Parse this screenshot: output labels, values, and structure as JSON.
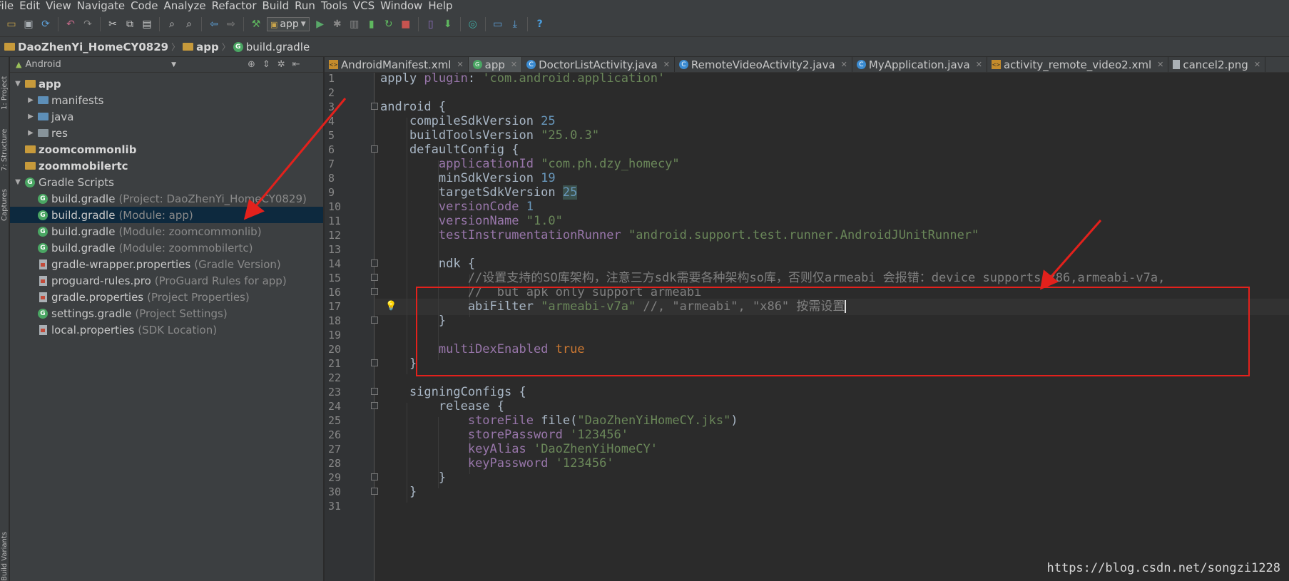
{
  "menu": {
    "items": [
      "File",
      "Edit",
      "View",
      "Navigate",
      "Code",
      "Analyze",
      "Refactor",
      "Build",
      "Run",
      "Tools",
      "VCS",
      "Window",
      "Help"
    ]
  },
  "toolbar": {
    "run_config": "app",
    "icons": [
      "open-icon",
      "save-icon",
      "sync-icon",
      "undo-icon",
      "redo-icon",
      "cut-icon",
      "copy-icon",
      "paste-icon",
      "find-icon",
      "replace-icon",
      "back-icon",
      "forward-icon",
      "build-icon",
      "run-icon",
      "debug-icon",
      "profile-icon",
      "attach-icon",
      "apply-changes-icon",
      "stop-icon",
      "avd-icon",
      "sdk-manager-icon",
      "gradle-sync-icon",
      "device-monitor-icon",
      "download-icon",
      "help-icon"
    ]
  },
  "breadcrumb": {
    "project": "DaoZhenYi_HomeCY0829",
    "module": "app",
    "file": "build.gradle"
  },
  "toolstrip": {
    "project_tab": "1: Project",
    "structure_tab": "7: Structure",
    "captures_tab": "Captures",
    "variants_tab": "Build Variants"
  },
  "project_panel": {
    "view_mode": "Android",
    "tree": [
      {
        "name": "app",
        "hint": "",
        "level": 0,
        "expanded": true,
        "icon": "module",
        "bold": true
      },
      {
        "name": "manifests",
        "hint": "",
        "level": 1,
        "expanded": false,
        "icon": "folder-blue",
        "bold": false
      },
      {
        "name": "java",
        "hint": "",
        "level": 1,
        "expanded": false,
        "icon": "folder-blue",
        "bold": false
      },
      {
        "name": "res",
        "hint": "",
        "level": 1,
        "expanded": false,
        "icon": "folder-res",
        "bold": false
      },
      {
        "name": "zoomcommonlib",
        "hint": "",
        "level": 0,
        "expanded": null,
        "icon": "module",
        "bold": true
      },
      {
        "name": "zoommobilertc",
        "hint": "",
        "level": 0,
        "expanded": null,
        "icon": "module",
        "bold": true
      },
      {
        "name": "Gradle Scripts",
        "hint": "",
        "level": 0,
        "expanded": true,
        "icon": "gradle",
        "bold": false
      },
      {
        "name": "build.gradle",
        "hint": "(Project: DaoZhenYi_HomeCY0829)",
        "level": 1,
        "expanded": null,
        "icon": "gradle",
        "bold": false
      },
      {
        "name": "build.gradle",
        "hint": "(Module: app)",
        "level": 1,
        "expanded": null,
        "icon": "gradle",
        "bold": false,
        "selected": true
      },
      {
        "name": "build.gradle",
        "hint": "(Module: zoomcommonlib)",
        "level": 1,
        "expanded": null,
        "icon": "gradle",
        "bold": false
      },
      {
        "name": "build.gradle",
        "hint": "(Module: zoommobilertc)",
        "level": 1,
        "expanded": null,
        "icon": "gradle",
        "bold": false
      },
      {
        "name": "gradle-wrapper.properties",
        "hint": "(Gradle Version)",
        "level": 1,
        "expanded": null,
        "icon": "properties",
        "bold": false
      },
      {
        "name": "proguard-rules.pro",
        "hint": "(ProGuard Rules for app)",
        "level": 1,
        "expanded": null,
        "icon": "text",
        "bold": false
      },
      {
        "name": "gradle.properties",
        "hint": "(Project Properties)",
        "level": 1,
        "expanded": null,
        "icon": "properties",
        "bold": false
      },
      {
        "name": "settings.gradle",
        "hint": "(Project Settings)",
        "level": 1,
        "expanded": null,
        "icon": "gradle",
        "bold": false
      },
      {
        "name": "local.properties",
        "hint": "(SDK Location)",
        "level": 1,
        "expanded": null,
        "icon": "properties",
        "bold": false
      }
    ]
  },
  "tabs": [
    {
      "label": "AndroidManifest.xml",
      "icon": "xml",
      "active": false
    },
    {
      "label": "app",
      "icon": "gradle",
      "active": true
    },
    {
      "label": "DoctorListActivity.java",
      "icon": "class",
      "active": false
    },
    {
      "label": "RemoteVideoActivity2.java",
      "icon": "class",
      "active": false
    },
    {
      "label": "MyApplication.java",
      "icon": "class",
      "active": false
    },
    {
      "label": "activity_remote_video2.xml",
      "icon": "xml",
      "active": false
    },
    {
      "label": "cancel2.png",
      "icon": "image",
      "active": false
    }
  ],
  "editor": {
    "line_numbers": [
      "1",
      "2",
      "3",
      "4",
      "5",
      "6",
      "7",
      "8",
      "9",
      "10",
      "11",
      "12",
      "13",
      "14",
      "15",
      "16",
      "17",
      "18",
      "19",
      "20",
      "21",
      "22",
      "23",
      "24",
      "25",
      "26",
      "27",
      "28",
      "29",
      "30",
      "31"
    ],
    "lines": [
      [
        [
          "fn",
          "apply "
        ],
        [
          "prop",
          "plugin"
        ],
        [
          "fn",
          ": "
        ],
        [
          "str",
          "'com.android.application'"
        ]
      ],
      [],
      [
        [
          "fn",
          "android {"
        ]
      ],
      [
        [
          "fn",
          "    compileSdkVersion "
        ],
        [
          "num",
          "25"
        ]
      ],
      [
        [
          "fn",
          "    buildToolsVersion "
        ],
        [
          "str",
          "\"25.0.3\""
        ]
      ],
      [
        [
          "fn",
          "    defaultConfig {"
        ]
      ],
      [
        [
          "fn",
          "        "
        ],
        [
          "prop",
          "applicationId "
        ],
        [
          "str",
          "\"com.ph.dzy_homecy\""
        ]
      ],
      [
        [
          "fn",
          "        minSdkVersion "
        ],
        [
          "num",
          "19"
        ]
      ],
      [
        [
          "fn",
          "        targetSdkVersion "
        ],
        [
          "numhl",
          "25"
        ]
      ],
      [
        [
          "fn",
          "        "
        ],
        [
          "prop",
          "versionCode "
        ],
        [
          "num",
          "1"
        ]
      ],
      [
        [
          "fn",
          "        "
        ],
        [
          "prop",
          "versionName "
        ],
        [
          "str",
          "\"1.0\""
        ]
      ],
      [
        [
          "fn",
          "        "
        ],
        [
          "prop",
          "testInstrumentationRunner "
        ],
        [
          "str",
          "\"android.support.test.runner.AndroidJUnitRunner\""
        ]
      ],
      [],
      [
        [
          "fn",
          "        ndk {"
        ]
      ],
      [
        [
          "cmt",
          "            //设置支持的SO库架构，注意三方sdk需要各种架构so库，否则仅armeabi 会报错：device supports x86,armeabi-v7a,"
        ]
      ],
      [
        [
          "cmt",
          "            //  but apk only support armeabi"
        ]
      ],
      [
        [
          "fn",
          "            abiFilter "
        ],
        [
          "str",
          "\"armeabi-v7a\" "
        ],
        [
          "cmt",
          "//, \"armeabi\", \"x86\" 按需设置"
        ],
        [
          "caret",
          ""
        ]
      ],
      [
        [
          "fn",
          "        }"
        ]
      ],
      [],
      [
        [
          "fn",
          "        "
        ],
        [
          "prop",
          "multiDexEnabled "
        ],
        [
          "kw",
          "true"
        ]
      ],
      [
        [
          "fn",
          "    }"
        ]
      ],
      [],
      [
        [
          "fn",
          "    signingConfigs {"
        ]
      ],
      [
        [
          "fn",
          "        release {"
        ]
      ],
      [
        [
          "fn",
          "            "
        ],
        [
          "prop",
          "storeFile "
        ],
        [
          "fn",
          "file("
        ],
        [
          "str",
          "\"DaoZhenYiHomeCY.jks\""
        ],
        [
          "fn",
          ")"
        ]
      ],
      [
        [
          "fn",
          "            "
        ],
        [
          "prop",
          "storePassword "
        ],
        [
          "str",
          "'123456'"
        ]
      ],
      [
        [
          "fn",
          "            "
        ],
        [
          "prop",
          "keyAlias "
        ],
        [
          "str",
          "'DaoZhenYiHomeCY'"
        ]
      ],
      [
        [
          "fn",
          "            "
        ],
        [
          "prop",
          "keyPassword "
        ],
        [
          "str",
          "'123456'"
        ]
      ],
      [
        [
          "fn",
          "        }"
        ]
      ],
      [
        [
          "fn",
          "    }"
        ]
      ],
      []
    ],
    "current_line": 17
  },
  "colors": {
    "annotation_red": "#e3211c",
    "background": "#2b2b2b",
    "panel": "#3c3f41",
    "selection": "#0d293e"
  },
  "watermark": "https://blog.csdn.net/songzi1228"
}
